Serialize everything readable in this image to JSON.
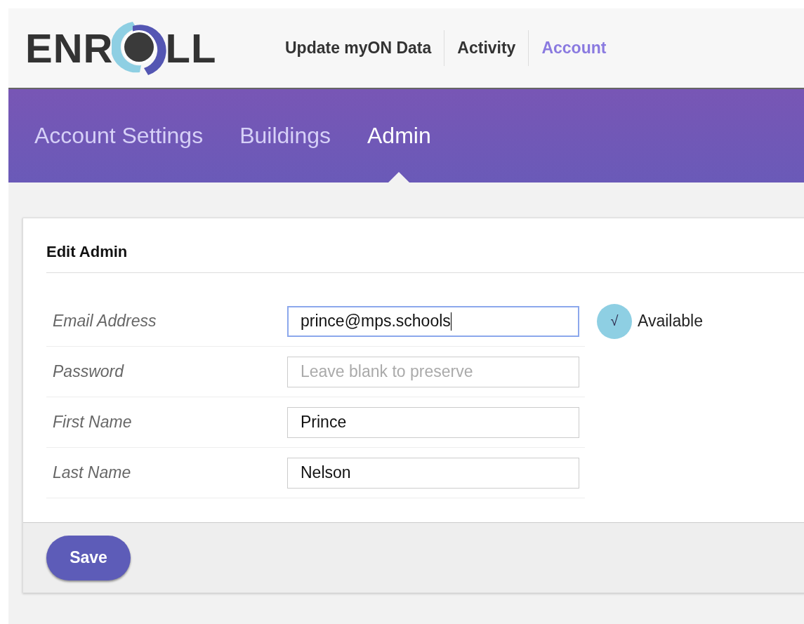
{
  "logo": {
    "before": "ENR",
    "after": "LL"
  },
  "top_nav": [
    {
      "label": "Update myON Data",
      "selected": false
    },
    {
      "label": "Activity",
      "selected": false
    },
    {
      "label": "Account",
      "selected": true
    }
  ],
  "tabs": [
    {
      "label": "Account Settings",
      "selected": false
    },
    {
      "label": "Buildings",
      "selected": false
    },
    {
      "label": "Admin",
      "selected": true
    }
  ],
  "form": {
    "title": "Edit Admin",
    "fields": [
      {
        "label": "Email Address",
        "value": "prince@mps.schools",
        "focused": true,
        "status": {
          "icon": "√",
          "label": "Available"
        }
      },
      {
        "label": "Password",
        "placeholder": "Leave blank to preserve",
        "focused": false
      },
      {
        "label": "First Name",
        "value": "Prince",
        "focused": false
      },
      {
        "label": "Last Name",
        "value": "Nelson",
        "focused": false
      }
    ],
    "save_button": "Save"
  }
}
